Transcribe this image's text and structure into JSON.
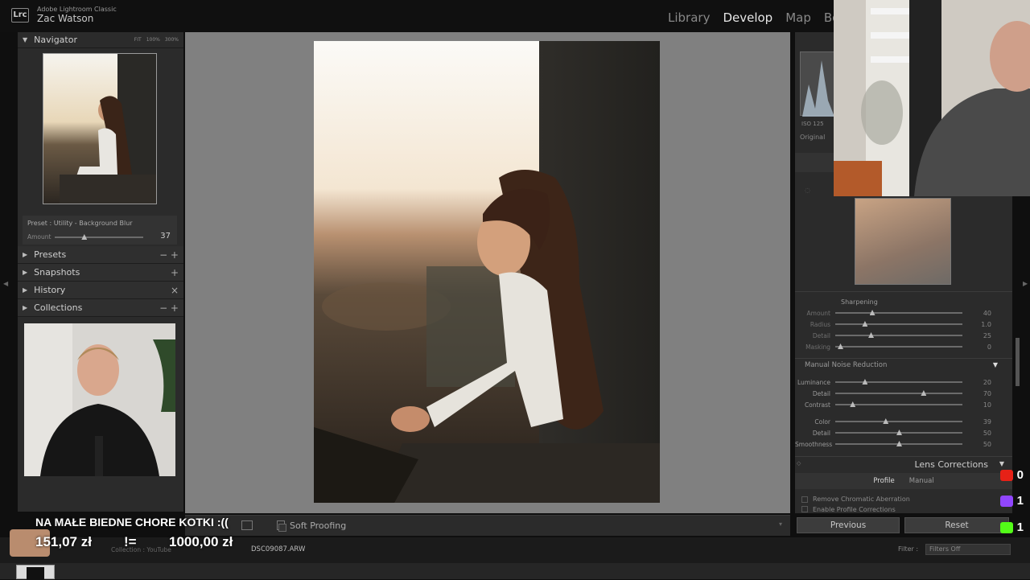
{
  "app": {
    "name": "Adobe Lightroom Classic",
    "user": "Zac Watson",
    "logo": "Lrc"
  },
  "modules": [
    "Library",
    "Develop",
    "Map",
    "Bo"
  ],
  "navigator": {
    "title": "Navigator",
    "zoom": [
      "FIT",
      "100%",
      "300%"
    ]
  },
  "preset": {
    "label": "Preset : Utility - Background Blur",
    "amount_label": "Amount",
    "amount_value": "37",
    "amount_fraction": 0.32
  },
  "left_panels": [
    {
      "label": "Presets",
      "buttons": "− +"
    },
    {
      "label": "Snapshots",
      "buttons": "+"
    },
    {
      "label": "History",
      "buttons": "×"
    },
    {
      "label": "Collections",
      "buttons": "− +"
    }
  ],
  "histogram": {
    "iso": "ISO 125",
    "original": "Original"
  },
  "sharpening": {
    "title": "Sharpening",
    "sliders": [
      {
        "label": "Amount",
        "value": "40",
        "pos": 0.28
      },
      {
        "label": "Radius",
        "value": "1.0",
        "pos": 0.22
      },
      {
        "label": "Detail",
        "value": "25",
        "pos": 0.27
      },
      {
        "label": "Masking",
        "value": "0",
        "pos": 0.02
      }
    ]
  },
  "noise": {
    "title": "Manual Noise Reduction",
    "luminance": [
      {
        "label": "Luminance",
        "value": "20",
        "pos": 0.22
      },
      {
        "label": "Detail",
        "value": "70",
        "pos": 0.7
      },
      {
        "label": "Contrast",
        "value": "10",
        "pos": 0.12
      }
    ],
    "color": [
      {
        "label": "Color",
        "value": "39",
        "pos": 0.39
      },
      {
        "label": "Detail",
        "value": "50",
        "pos": 0.5
      },
      {
        "label": "Smoothness",
        "value": "50",
        "pos": 0.5
      }
    ]
  },
  "lens": {
    "title": "Lens Corrections",
    "tabs": [
      "Profile",
      "Manual"
    ],
    "options": [
      "Remove Chromatic Aberration",
      "Enable Profile Corrections"
    ]
  },
  "buttons": {
    "previous": "Previous",
    "reset": "Reset"
  },
  "toolbar": {
    "soft_proofing": "Soft Proofing"
  },
  "filmbar": {
    "collection": "Collection : YouTube",
    "filename": "DSC09087.ARW",
    "filter_label": "Filter :",
    "filter_value": "Filters Off"
  },
  "overlay": {
    "title": "NA MAŁE BIEDNE CHORE KOTKI :((",
    "raised": "151,07 zł",
    "sep": "!=",
    "goal": "1000,00 zł",
    "counters": [
      {
        "icon": "youtube-icon",
        "value": "0",
        "color": "#e62117"
      },
      {
        "icon": "twitch-icon",
        "value": "1",
        "color": "#9146ff"
      },
      {
        "icon": "kick-icon",
        "value": "1",
        "color": "#53fc18"
      }
    ]
  }
}
